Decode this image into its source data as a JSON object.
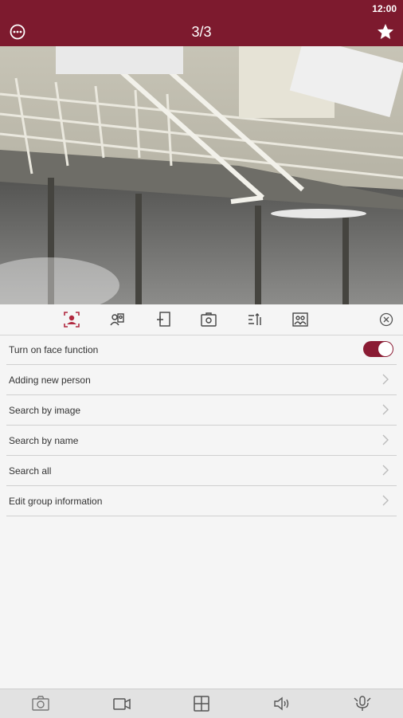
{
  "status_bar": {
    "time": "12:00"
  },
  "header": {
    "title": "3/3",
    "menu_icon": "more-icon",
    "favorite_icon": "star-icon"
  },
  "camera": {
    "feed": "live-camera-view"
  },
  "panel": {
    "tabs": [
      {
        "icon": "face-recognition-icon",
        "active": true
      },
      {
        "icon": "person-compare-icon",
        "active": false
      },
      {
        "icon": "add-face-icon",
        "active": false
      },
      {
        "icon": "face-search-icon",
        "active": false
      },
      {
        "icon": "adjust-icon",
        "active": false
      },
      {
        "icon": "group-icon",
        "active": false
      }
    ],
    "close_icon": "close-icon",
    "rows": {
      "face_function": {
        "label": "Turn on face function",
        "toggle_on": true
      },
      "add_person": {
        "label": "Adding new person"
      },
      "search_image": {
        "label": "Search by image"
      },
      "search_name": {
        "label": "Search by name"
      },
      "search_all": {
        "label": "Search all"
      },
      "edit_group": {
        "label": "Edit group information"
      }
    }
  },
  "bottom_bar": {
    "items": [
      "snapshot-icon",
      "record-icon",
      "layout-grid-icon",
      "speaker-icon",
      "microphone-icon"
    ]
  },
  "colors": {
    "brand": "#7d1a2e",
    "toggle_active": "#8a1b33",
    "active_tab_icon": "#b0283f"
  }
}
